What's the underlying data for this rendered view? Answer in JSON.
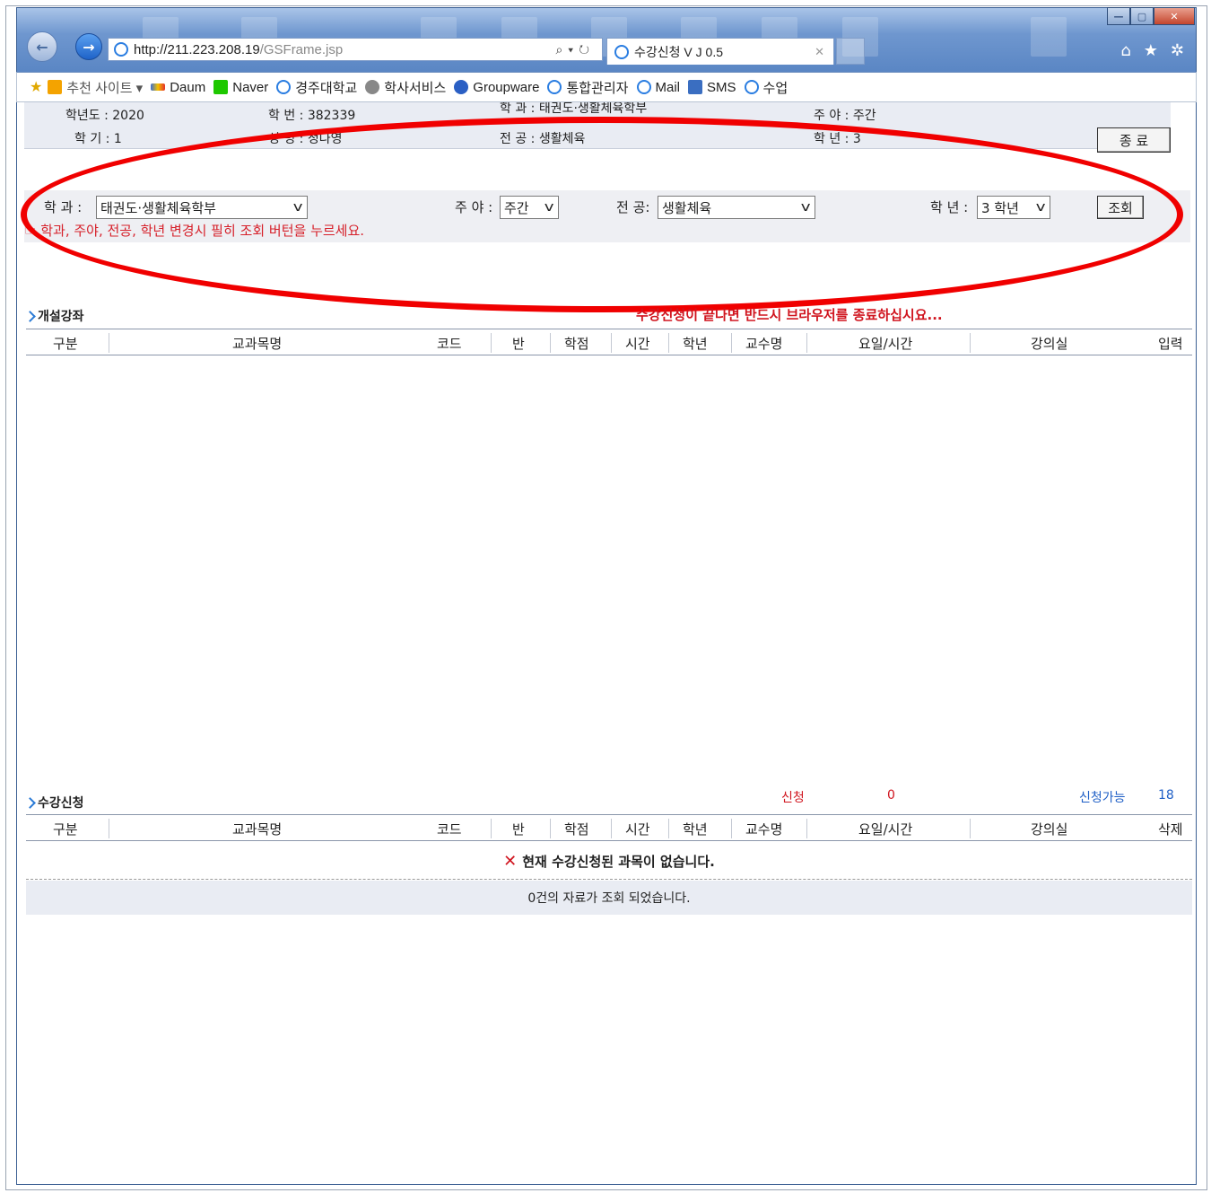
{
  "browser": {
    "url_host": "http://211.223.208.19",
    "url_path": "/GSFrame.jsp",
    "tab_title": "수강신청 V J 0.5"
  },
  "favorites": [
    {
      "label": "추천 사이트 ▾",
      "icon": "bing-icon",
      "color": "#f4a300"
    },
    {
      "label": "Daum",
      "icon": "daum-icon",
      "color": "#3b6fd6"
    },
    {
      "label": "Naver",
      "icon": "naver-icon",
      "color": "#1ec800"
    },
    {
      "label": "경주대학교",
      "icon": "ie-page-icon",
      "color": "#2a7de1"
    },
    {
      "label": "학사서비스",
      "icon": "person-icon",
      "color": "#777777"
    },
    {
      "label": "Groupware",
      "icon": "globe-icon",
      "color": "#2a5fc4"
    },
    {
      "label": "통합관리자",
      "icon": "ie-page-icon",
      "color": "#2a7de1"
    },
    {
      "label": "Mail",
      "icon": "ie-page-icon",
      "color": "#2a7de1"
    },
    {
      "label": "SMS",
      "icon": "computer-icon",
      "color": "#3a6ec1"
    },
    {
      "label": "수업",
      "icon": "ie-page-icon",
      "color": "#2a7de1"
    }
  ],
  "student": {
    "year": "학년도 : 2020",
    "term": "학 기 : 1",
    "id": "학 번 : 382339",
    "name": "성 명 : 정나영",
    "dept": "학 과 : 태권도·생활체육학부",
    "major": "전 공 : 생활체육",
    "shift": "주 야 : 주간",
    "grade": "학 년 : 3",
    "close_button": "종 료"
  },
  "filter": {
    "dept_label": "학 과 :",
    "dept_value": "태권도·생활체육학부",
    "shift_label": "주 야 :",
    "shift_value": "주간",
    "major_label": "전 공:",
    "major_value": "생활체육",
    "grade_label": "학 년 :",
    "grade_value": "3 학년",
    "search_button": "조회",
    "notice": "☞ 학과, 주야, 전공, 학년 변경시 필히 조회 버턴을 누르세요."
  },
  "open_courses": {
    "title": "개설강좌",
    "warning": "수강신청이 끝나면 반드시 브라우저를 종료하십시요...",
    "columns": [
      "구분",
      "교과목명",
      "코드",
      "반",
      "학점",
      "시간",
      "학년",
      "교수명",
      "요일/시간",
      "강의실",
      "입력"
    ]
  },
  "registration": {
    "title": "수강신청",
    "applied_label": "신청",
    "applied_count": "0",
    "available_label": "신청가능",
    "available_count": "18",
    "columns": [
      "구분",
      "교과목명",
      "코드",
      "반",
      "학점",
      "시간",
      "학년",
      "교수명",
      "요일/시간",
      "강의실",
      "삭제"
    ],
    "empty_message": "현재 수강신청된 과목이 없습니다.",
    "result_message": "0건의 자료가 조회 되었습니다."
  },
  "colors": {
    "warning": "#d0141e",
    "highlight_oval": "#f00000",
    "link_blue": "#1f5fc6"
  }
}
